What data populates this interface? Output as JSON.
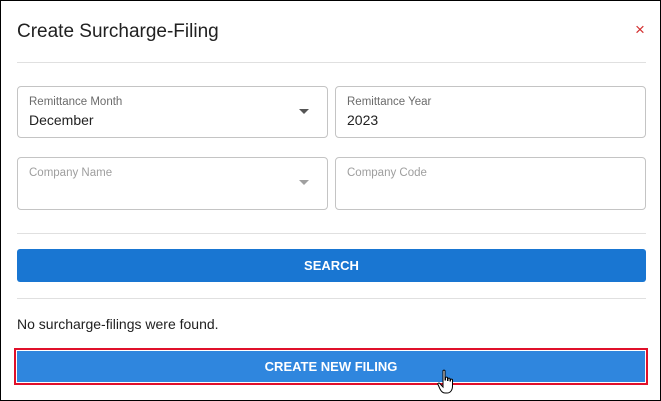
{
  "dialog": {
    "title": "Create Surcharge-Filing",
    "close_symbol": "×",
    "colors": {
      "primary_button": "#1976d2",
      "highlight_border": "#e0102a",
      "close_icon": "#d32f2f"
    }
  },
  "form": {
    "remittance_month": {
      "label": "Remittance Month",
      "value": "December"
    },
    "remittance_year": {
      "label": "Remittance Year",
      "value": "2023"
    },
    "company_name": {
      "label": "Company Name",
      "value": ""
    },
    "company_code": {
      "label": "Company Code",
      "value": ""
    }
  },
  "actions": {
    "search_label": "SEARCH",
    "create_label": "CREATE NEW FILING"
  },
  "results": {
    "empty_message": "No surcharge-filings were found."
  },
  "icons": {
    "close": "close-icon",
    "dropdown": "chevron-down-icon",
    "cursor": "hand-pointer-icon"
  }
}
